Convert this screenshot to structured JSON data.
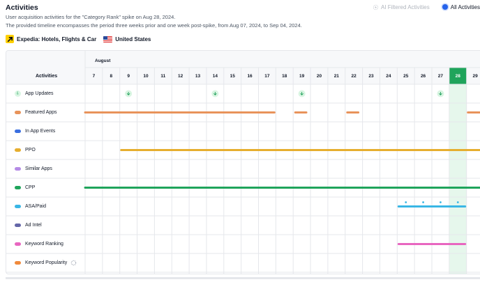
{
  "header": {
    "title": "Activities",
    "description_line1": "User acquisition activities for the \"Category Rank\" spike on Aug 28, 2024.",
    "description_line2": "The provided timeline encompasses the period three weeks prior and one week post-spike, from Aug 07, 2024, to Sep 04, 2024."
  },
  "filters": {
    "ai_filtered_label": "AI Filtered Activities",
    "all_label": "All Activities",
    "selected": "All Activities"
  },
  "app": {
    "name": "Expedia: Hotels, Flights & Car",
    "country": "United States",
    "icon": "expedia-arrow-icon",
    "flag": "us-flag-icon"
  },
  "table": {
    "activities_header": "Activities",
    "month": "August",
    "days": [
      "7",
      "8",
      "9",
      "10",
      "11",
      "12",
      "13",
      "14",
      "15",
      "16",
      "17",
      "18",
      "19",
      "20",
      "21",
      "22",
      "23",
      "24",
      "25",
      "26",
      "27",
      "28",
      "29"
    ],
    "highlight_day": "28",
    "rows": [
      {
        "label": "App Updates",
        "color": "#22a05c",
        "type": "updates",
        "markers": [
          "9",
          "14",
          "19",
          "27"
        ]
      },
      {
        "label": "Featured Apps",
        "color": "#e8935a",
        "type": "bars",
        "segments": [
          [
            "7",
            "17"
          ],
          [
            "19",
            "19"
          ],
          [
            "22",
            "22"
          ],
          [
            "29",
            "29"
          ]
        ]
      },
      {
        "label": "In App Events",
        "color": "#3b6fe0",
        "type": "bars",
        "segments": []
      },
      {
        "label": "PPO",
        "color": "#e6ae2f",
        "type": "bars",
        "segments": [
          [
            "9",
            "29"
          ]
        ]
      },
      {
        "label": "Similar Apps",
        "color": "#b58be6",
        "type": "bars",
        "segments": []
      },
      {
        "label": "CPP",
        "color": "#1fa45b",
        "type": "bars",
        "segments": [
          [
            "7",
            "29"
          ]
        ]
      },
      {
        "label": "ASA/Paid",
        "color": "#39b6e5",
        "type": "bars",
        "segments": [
          [
            "25",
            "28"
          ]
        ],
        "dots": [
          "25",
          "26",
          "27",
          "28"
        ]
      },
      {
        "label": "Ad Intel",
        "color": "#6466a8",
        "type": "bars",
        "segments": []
      },
      {
        "label": "Keyword Ranking",
        "color": "#e866c0",
        "type": "bars",
        "segments": [
          [
            "25",
            "28"
          ]
        ]
      },
      {
        "label": "Keyword Popularity",
        "color": "#f08a3c",
        "type": "bars",
        "segments": [],
        "loading": true
      }
    ]
  },
  "colors": {
    "highlight": "#1fa45b",
    "highlight_column": "#e6f7ec",
    "grid": "#e5e7eb",
    "header_bg": "#f7f8fa"
  }
}
